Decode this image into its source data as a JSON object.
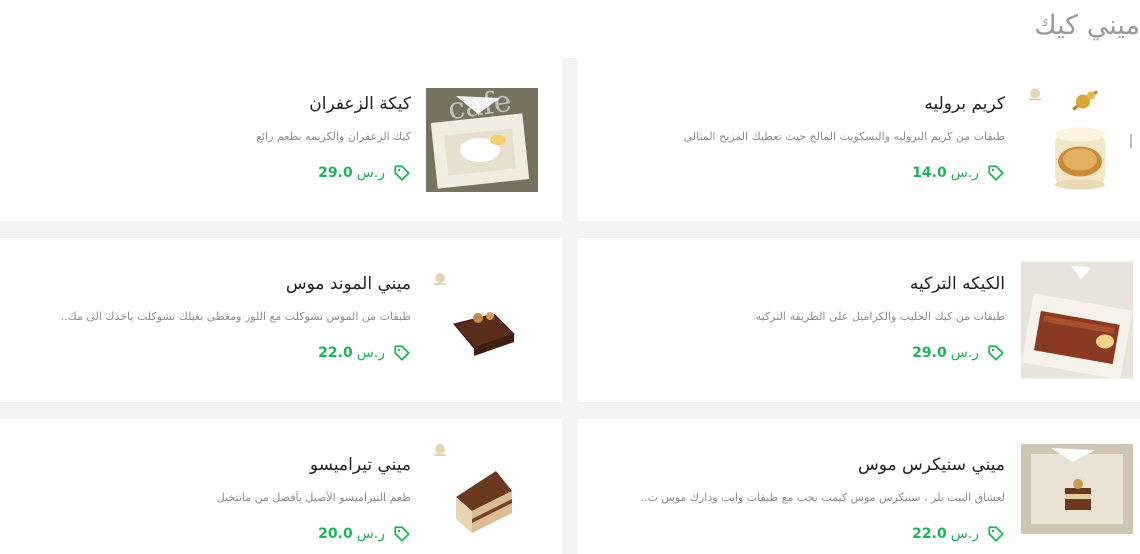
{
  "section": {
    "title": "ميني كيك"
  },
  "currency": "ر.س",
  "colors": {
    "price": "#1fb35a",
    "title": "#9a9a9a",
    "text": "#222222",
    "muted": "#8d8d8d"
  },
  "items": [
    {
      "name": "كريم بروليه",
      "desc": "طبقات من كريم البروليه والبسكويت المالح حيث تعطيك المزيج المثالي",
      "price": "14.0",
      "image": "creme-brulee-jar"
    },
    {
      "name": "كيكة الزعفران",
      "desc": "كيك الزعفران والكريمه بطعم رائع",
      "price": "29.0",
      "image": "saffron-cake-box"
    },
    {
      "name": "الكيكه التركيه",
      "desc": "طبقات من كيك الحليب والكراميل على الطريقه التركيه",
      "price": "29.0",
      "image": "turkish-cake-box"
    },
    {
      "name": "ميني الموند موس",
      "desc": "طبقات من الموس تشوكلت مع اللوز ومغطى بغيلك تشوكلت ياخذك الى مك..",
      "price": "22.0",
      "image": "almond-mousse-slice"
    },
    {
      "name": "ميني سنيكرس موس",
      "desc": "لعشاق البيت بلر ، سنيكرس موس كيمت يحب مع طبقات وايت ودارك موس ت..",
      "price": "22.0",
      "image": "snickers-mousse-box"
    },
    {
      "name": "ميني تيراميسو",
      "desc": "طعم التيراميسو الأصيل بأفضل من ماتتخيل",
      "price": "20.0",
      "image": "tiramisu-slice"
    }
  ],
  "watermark": "cafe"
}
